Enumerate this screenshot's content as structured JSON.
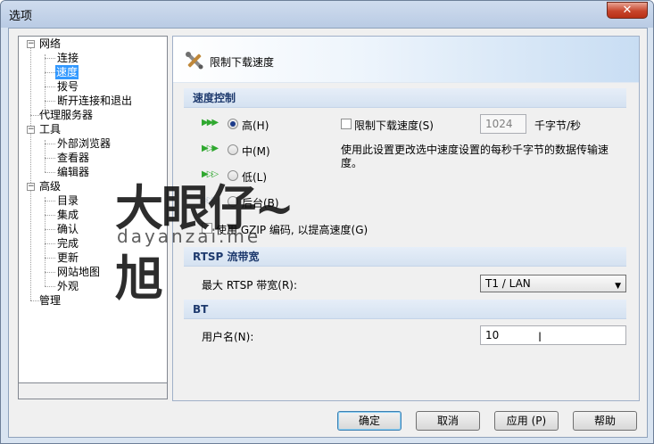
{
  "window": {
    "title": "选项",
    "close_glyph": "✕"
  },
  "tree": {
    "items": [
      {
        "label": "网络",
        "expander": "−"
      },
      {
        "label": "连接"
      },
      {
        "label": "速度",
        "selected": true
      },
      {
        "label": "拨号"
      },
      {
        "label": "断开连接和退出"
      },
      {
        "label": "代理服务器"
      },
      {
        "label": "工具",
        "expander": "−"
      },
      {
        "label": "外部浏览器"
      },
      {
        "label": "查看器"
      },
      {
        "label": "编辑器"
      },
      {
        "label": "高级",
        "expander": "−"
      },
      {
        "label": "目录"
      },
      {
        "label": "集成"
      },
      {
        "label": "确认"
      },
      {
        "label": "完成"
      },
      {
        "label": "更新"
      },
      {
        "label": "网站地图"
      },
      {
        "label": "外观"
      },
      {
        "label": "管理"
      }
    ]
  },
  "pane": {
    "title": "限制下载速度",
    "icon": "tools-icon",
    "speed_section": {
      "heading": "速度控制",
      "options": [
        {
          "label": "高(H)",
          "checked": true,
          "arrow_color": "#2fa82f"
        },
        {
          "label": "中(M)",
          "checked": false,
          "arrow_color": "#2fa82f"
        },
        {
          "label": "低(L)",
          "checked": false,
          "arrow_color": "#2fa82f"
        },
        {
          "label": "后台(B)",
          "checked": false,
          "arrow_color": "#b8c2d0"
        }
      ],
      "limit_checkbox_label": "限制下载速度(S)",
      "limit_value": "1024",
      "limit_unit": "千字节/秒",
      "description": "使用此设置更改选中速度设置的每秒千字节的数据传输速度。",
      "gzip_label": "使用 GZIP 编码, 以提高速度(G)"
    },
    "rtsp_section": {
      "heading": "RTSP 流带宽",
      "max_label": "最大 RTSP 带宽(R):",
      "max_value": "T1 / LAN"
    },
    "bt_section": {
      "heading": "BT",
      "username_label": "用户名(N):",
      "username_value": "10"
    }
  },
  "buttons": {
    "ok": "确定",
    "cancel": "取消",
    "apply": "应用 (P)",
    "help": "帮助"
  },
  "watermark": {
    "main": "大眼仔~旭",
    "sub": "dayanzai.me"
  }
}
